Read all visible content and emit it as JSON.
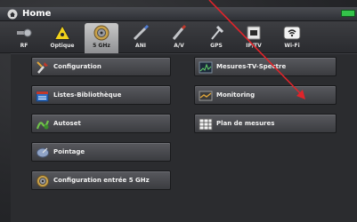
{
  "window": {
    "title": "Home"
  },
  "tabs": [
    {
      "id": "rf",
      "label": "RF",
      "icon": "rf-connector-icon",
      "active": false
    },
    {
      "id": "optique",
      "label": "Optique",
      "icon": "laser-warning-icon",
      "active": false
    },
    {
      "id": "5ghz",
      "label": "5 GHz",
      "icon": "coax-connector-icon",
      "active": true
    },
    {
      "id": "ani",
      "label": "ANI",
      "icon": "probe-cable-icon",
      "active": false
    },
    {
      "id": "av",
      "label": "A/V",
      "icon": "av-cable-icon",
      "active": false
    },
    {
      "id": "gps",
      "label": "GPS",
      "icon": "gps-antenna-icon",
      "active": false
    },
    {
      "id": "ip",
      "label": "IP/TV",
      "icon": "network-port-icon",
      "active": false
    },
    {
      "id": "wifi",
      "label": "Wi-Fi",
      "icon": "wifi-icon",
      "active": false
    }
  ],
  "menu": {
    "configuration": "Configuration",
    "listes": "Listes-Bibliothèque",
    "autoset": "Autoset",
    "pointage": "Pointage",
    "config5ghz": "Configuration entrée 5 GHz",
    "mesures": "Mesures-TV-Spectre",
    "monitoring": "Monitoring",
    "plan": "Plan de mesures"
  },
  "colors": {
    "annotation_arrow": "#e0242a",
    "battery": "#34c34a"
  }
}
